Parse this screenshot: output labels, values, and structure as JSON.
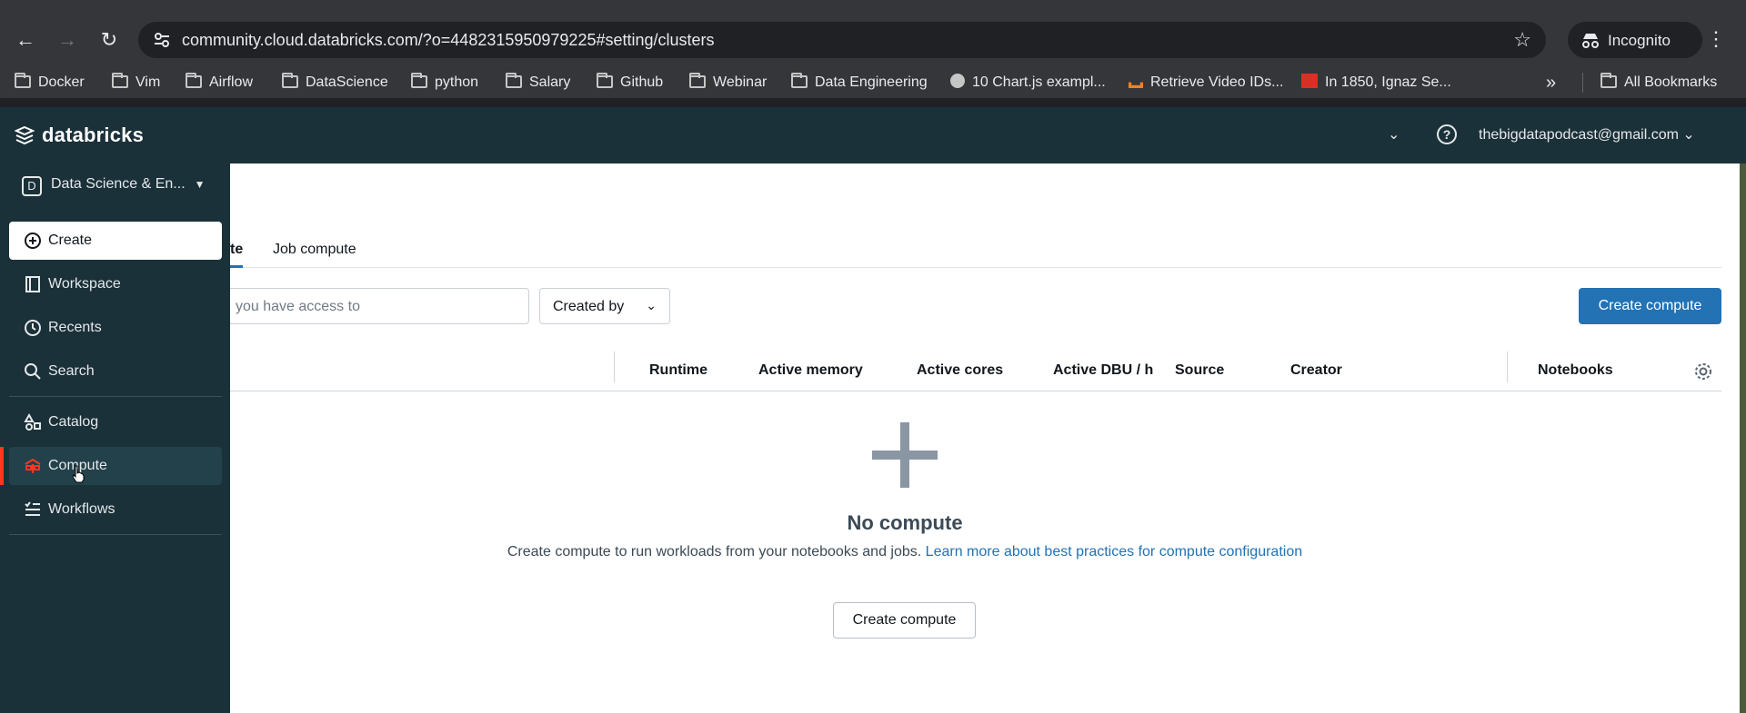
{
  "browser": {
    "url": "community.cloud.databricks.com/?o=4482315950979225#setting/clusters",
    "profile_label": "Incognito",
    "bookmarks": [
      {
        "label": "Docker",
        "icon": "folder-icon"
      },
      {
        "label": "Vim",
        "icon": "folder-icon"
      },
      {
        "label": "Airflow",
        "icon": "folder-icon"
      },
      {
        "label": "DataScience",
        "icon": "folder-icon"
      },
      {
        "label": "python",
        "icon": "folder-icon"
      },
      {
        "label": "Salary",
        "icon": "folder-icon"
      },
      {
        "label": "Github",
        "icon": "folder-icon"
      },
      {
        "label": "Webinar",
        "icon": "folder-icon"
      },
      {
        "label": "Data Engineering",
        "icon": "folder-icon"
      },
      {
        "label": "10 Chart.js exampl...",
        "icon": "globe-icon"
      },
      {
        "label": "Retrieve Video IDs...",
        "icon": "stackoverflow-icon"
      },
      {
        "label": "In 1850, Ignaz Se...",
        "icon": "reddit-favicon-icon"
      }
    ],
    "all_bookmarks_label": "All Bookmarks"
  },
  "app": {
    "logo_text": "databricks",
    "user_email": "thebigdatapodcast@gmail.com",
    "workspace_badge": "D",
    "workspace_name": "Data Science & En..."
  },
  "sidebar": {
    "items": [
      {
        "label": "Create",
        "icon": "plus-circle-icon"
      },
      {
        "label": "Workspace",
        "icon": "workspace-icon"
      },
      {
        "label": "Recents",
        "icon": "clock-icon"
      },
      {
        "label": "Search",
        "icon": "search-icon"
      },
      {
        "label": "Catalog",
        "icon": "catalog-icon"
      },
      {
        "label": "Compute",
        "icon": "compute-icon"
      },
      {
        "label": "Workflows",
        "icon": "workflows-icon"
      }
    ],
    "active": "Compute"
  },
  "main": {
    "tabs": [
      {
        "label": "te",
        "active": true
      },
      {
        "label": "Job compute",
        "active": false
      }
    ],
    "search_placeholder": "you have access to",
    "filter_label": "Created by",
    "create_button": "Create compute",
    "columns": [
      "Runtime",
      "Active memory",
      "Active cores",
      "Active DBU / h",
      "Source",
      "Creator",
      "Notebooks"
    ],
    "empty": {
      "title": "No compute",
      "description": "Create compute to run workloads from your notebooks and jobs.",
      "link": "Learn more about best practices for compute configuration",
      "button": "Create compute"
    }
  },
  "colors": {
    "brand_dark": "#1b3139",
    "primary": "#2272b4",
    "active_indicator": "#ff3621"
  }
}
